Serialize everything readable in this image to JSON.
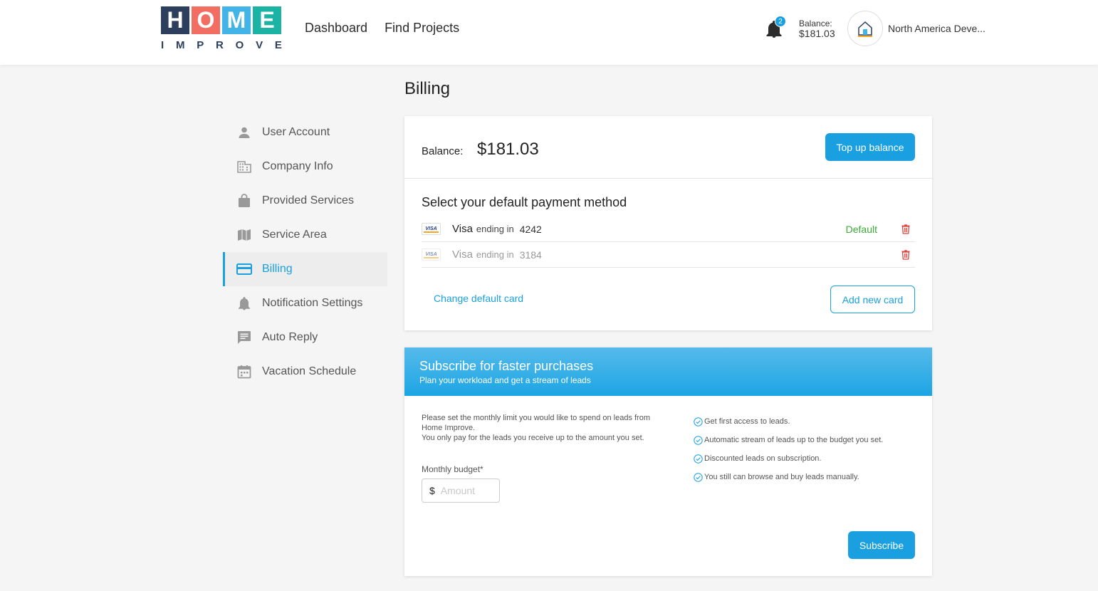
{
  "header": {
    "logo_letters": [
      "H",
      "O",
      "M",
      "E"
    ],
    "logo_colors": [
      "#2d3f5c",
      "#f26e63",
      "#43b4e7",
      "#1bb3a4"
    ],
    "logo_sub": [
      "I",
      "M",
      "P",
      "R",
      "O",
      "V",
      "E"
    ],
    "nav": [
      "Dashboard",
      "Find Projects"
    ],
    "notifications_count": "2",
    "balance_label": "Balance:",
    "balance_value": "$181.03",
    "company_name": "North America Deve..."
  },
  "page_title": "Billing",
  "sidebar": {
    "items": [
      {
        "label": "User Account",
        "icon": "person-icon"
      },
      {
        "label": "Company Info",
        "icon": "building-icon"
      },
      {
        "label": "Provided Services",
        "icon": "bag-icon"
      },
      {
        "label": "Service Area",
        "icon": "map-icon"
      },
      {
        "label": "Billing",
        "icon": "credit-card-icon",
        "active": true
      },
      {
        "label": "Notification Settings",
        "icon": "bell-icon"
      },
      {
        "label": "Auto Reply",
        "icon": "message-icon"
      },
      {
        "label": "Vacation Schedule",
        "icon": "calendar-icon"
      }
    ]
  },
  "billing": {
    "balance_label": "Balance:",
    "balance_value": "$181.03",
    "topup_label": "Top up balance",
    "payment_title": "Select your default payment method",
    "cards": [
      {
        "brand": "Visa",
        "ending_label": "ending in",
        "last4": "4242",
        "default_label": "Default"
      },
      {
        "brand": "Visa",
        "ending_label": "ending in",
        "last4": "3184"
      }
    ],
    "change_default_label": "Change default card",
    "add_card_label": "Add new card"
  },
  "subscribe": {
    "title": "Subscribe for faster purchases",
    "subtitle": "Plan your workload and get a stream of leads",
    "desc1": "Please set the monthly limit you would like to spend on leads from Home Improve.",
    "desc2": "You only pay for the leads you receive up to the amount you set.",
    "budget_label": "Monthly budget*",
    "currency": "$",
    "amount_placeholder": "Amount",
    "benefits": [
      "Get first access to leads.",
      "Automatic stream of leads up to the budget you set.",
      "Discounted leads on subscription.",
      "You still can browse and buy leads manually."
    ],
    "button_label": "Subscribe"
  },
  "colors": {
    "accent": "#1aa0e0",
    "default_green": "#3aaa35",
    "trash_red": "#e0443c"
  }
}
